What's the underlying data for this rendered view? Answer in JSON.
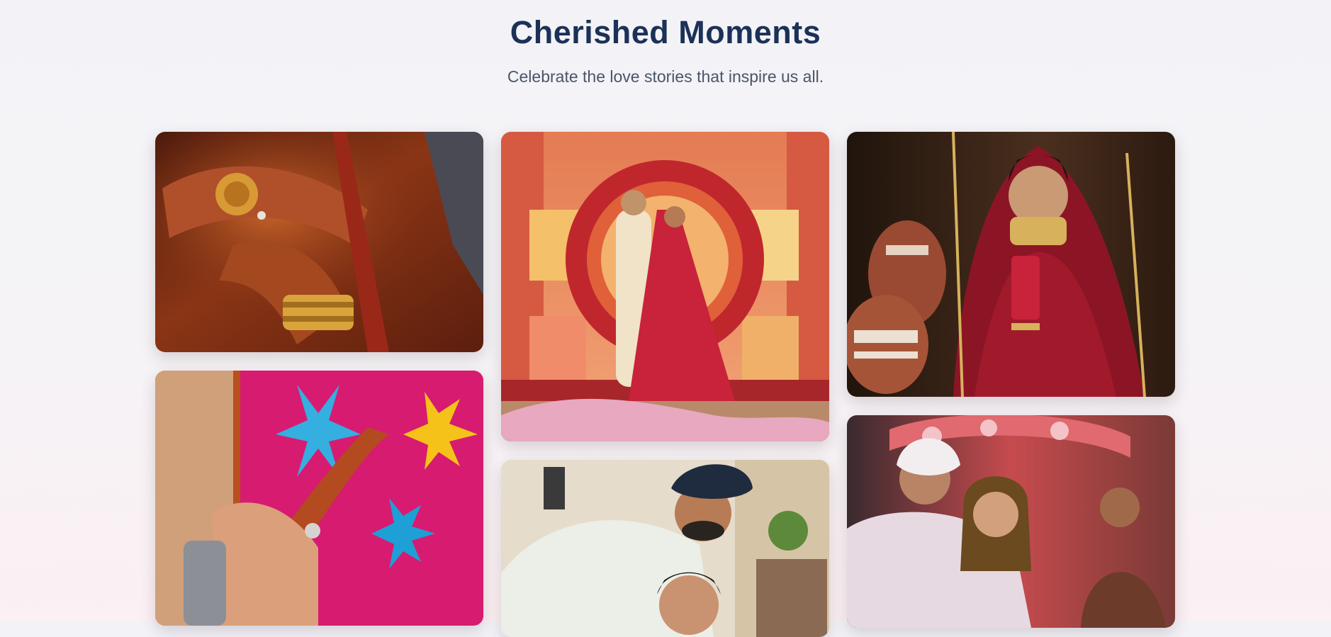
{
  "hero": {
    "title": "Cherished Moments",
    "subtitle": "Celebrate the love stories that inspire us all."
  },
  "gallery": {
    "photos": [
      {
        "id": "photo-hands-jewelry",
        "subject": "henna-hands-gold-bangles-image",
        "palette": [
          "#6a2510",
          "#b4541f",
          "#d79a3c"
        ]
      },
      {
        "id": "photo-ring-ceremony",
        "subject": "ring-on-henna-hand-image",
        "palette": [
          "#d51a6f",
          "#1e9fd6",
          "#c4542a"
        ]
      },
      {
        "id": "photo-couple-floral-stage",
        "subject": "couple-in-front-of-floral-arch-image",
        "palette": [
          "#e8895a",
          "#c8233a",
          "#f1e2c6"
        ]
      },
      {
        "id": "photo-couple-portrait",
        "subject": "groom-in-turban-with-bride-image",
        "palette": [
          "#1f2c3f",
          "#e6e7df",
          "#b77c56"
        ]
      },
      {
        "id": "photo-bride-pot",
        "subject": "bride-beside-clay-pot-image",
        "palette": [
          "#2c1a10",
          "#8c1525",
          "#d7b15c"
        ]
      },
      {
        "id": "photo-ceremony-smile",
        "subject": "bride-and-groom-ceremony-image",
        "palette": [
          "#c9525a",
          "#e7d9e2",
          "#6c3b2a"
        ]
      }
    ]
  }
}
